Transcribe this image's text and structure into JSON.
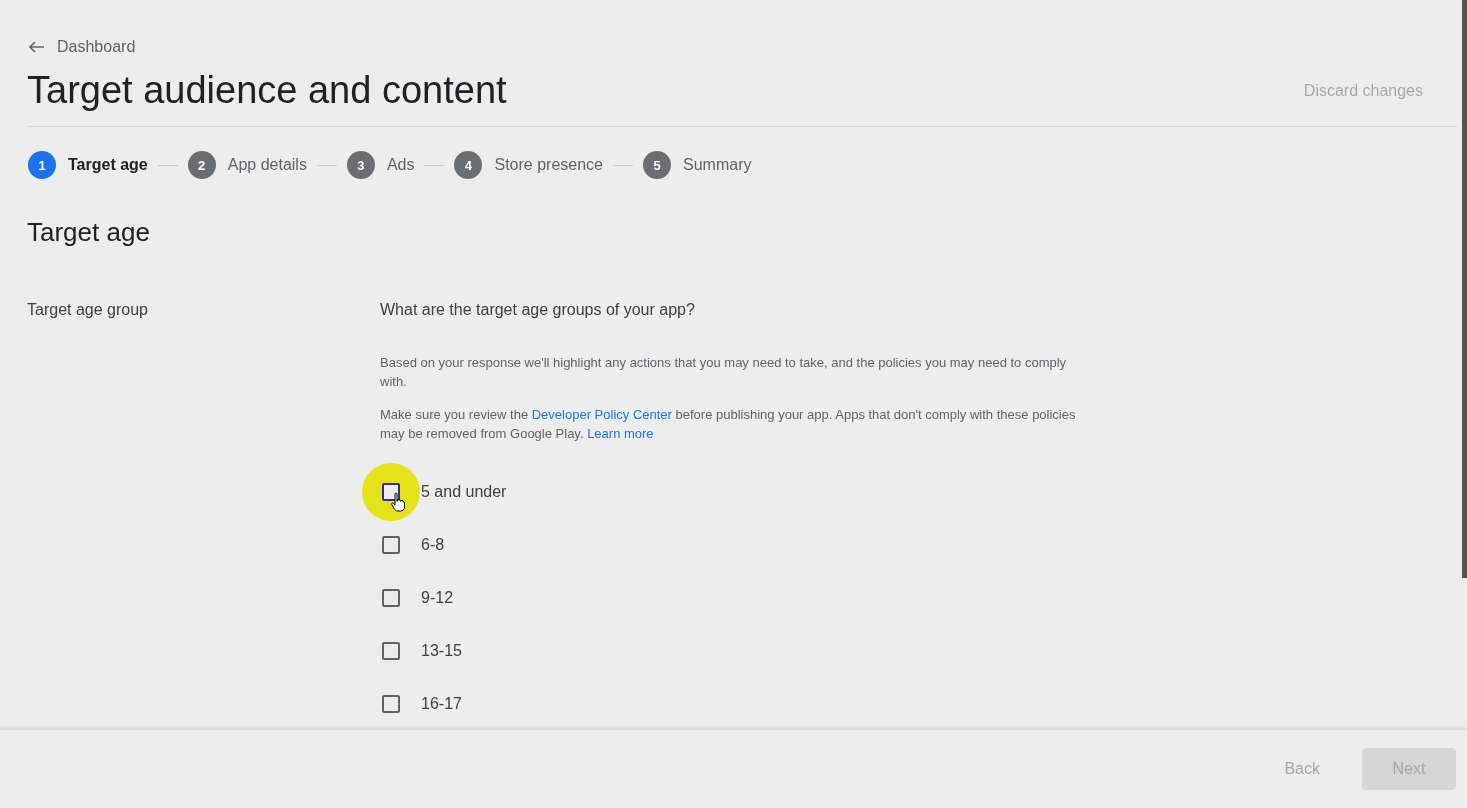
{
  "back_link": {
    "label": "Dashboard"
  },
  "title": "Target audience and content",
  "discard": {
    "label": "Discard changes",
    "disabled": true
  },
  "steps": [
    {
      "number": "1",
      "label": "Target age",
      "selected": true
    },
    {
      "number": "2",
      "label": "App details",
      "selected": false
    },
    {
      "number": "3",
      "label": "Ads",
      "selected": false
    },
    {
      "number": "4",
      "label": "Store presence",
      "selected": false
    },
    {
      "number": "5",
      "label": "Summary",
      "selected": false
    }
  ],
  "section_title": "Target age",
  "field_label": "Target age group",
  "question": "What are the target age groups of your app?",
  "info": "Based on your response we'll highlight any actions that you may need to take, and the policies you may need to comply with.",
  "notice": [
    {
      "kind": "text",
      "text": "Make sure you review the "
    },
    {
      "kind": "link",
      "text": "Developer Policy Center"
    },
    {
      "kind": "text",
      "text": " before publishing your app. Apps that don't comply with these policies may be removed from Google Play. "
    },
    {
      "kind": "link",
      "text": "Learn more"
    }
  ],
  "age_groups": [
    {
      "label": "5 and under",
      "checked": false,
      "hovered": true
    },
    {
      "label": "6-8",
      "checked": false,
      "hovered": false
    },
    {
      "label": "9-12",
      "checked": false,
      "hovered": false
    },
    {
      "label": "13-15",
      "checked": false,
      "hovered": false
    },
    {
      "label": "16-17",
      "checked": false,
      "hovered": false
    }
  ],
  "footer_buttons": [
    {
      "label": "Back",
      "kind": "text",
      "disabled": true
    },
    {
      "label": "Next",
      "kind": "filled",
      "disabled": true
    }
  ]
}
